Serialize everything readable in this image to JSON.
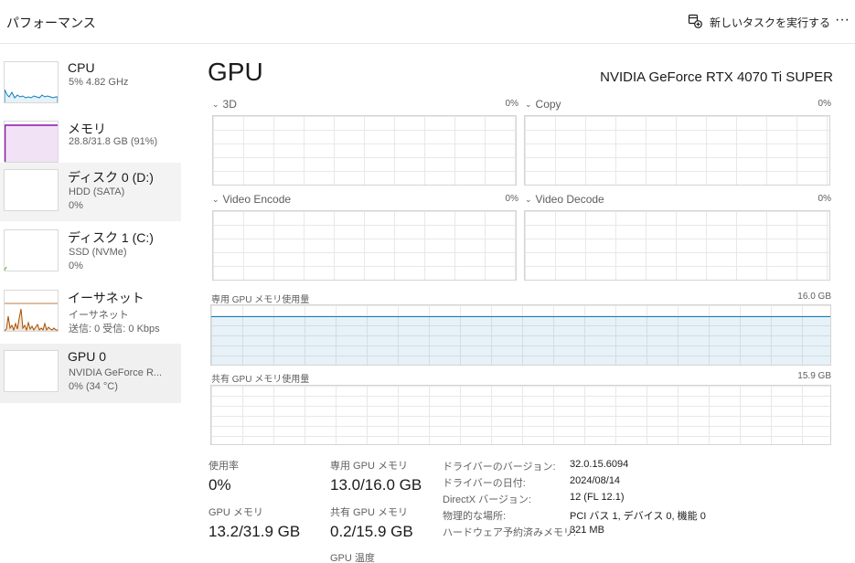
{
  "header": {
    "title": "パフォーマンス",
    "new_task_label": "新しいタスクを実行する",
    "more_label": "···"
  },
  "sidebar": {
    "items": [
      {
        "title": "CPU",
        "sub1": "5%  4.82 GHz",
        "sub2": "",
        "sub3": "",
        "color": "#117dbb"
      },
      {
        "title": "メモリ",
        "sub1": "28.8/31.8 GB (91%)",
        "sub2": "",
        "sub3": "",
        "color": "#8b12ae"
      },
      {
        "title": "ディスク 0 (D:)",
        "sub1": "HDD (SATA)",
        "sub2": "0%",
        "sub3": "",
        "color": "#4da60c"
      },
      {
        "title": "ディスク 1 (C:)",
        "sub1": "SSD (NVMe)",
        "sub2": "0%",
        "sub3": "",
        "color": "#4da60c"
      },
      {
        "title": "イーサネット",
        "sub1": "イーサネット",
        "sub2": "送信: 0 受信: 0 Kbps",
        "sub3": "",
        "color": "#a74f01"
      },
      {
        "title": "GPU 0",
        "sub1": "NVIDIA GeForce R...",
        "sub2": "0% (34 °C)",
        "sub3": "",
        "color": "#117dbb"
      }
    ]
  },
  "main": {
    "title": "GPU",
    "gpu_name": "NVIDIA GeForce RTX 4070 Ti SUPER",
    "engines": [
      {
        "label": "3D",
        "pct": "0%"
      },
      {
        "label": "Copy",
        "pct": "0%"
      },
      {
        "label": "Video Encode",
        "pct": "0%"
      },
      {
        "label": "Video Decode",
        "pct": "0%"
      }
    ],
    "dedicated_mem": {
      "label": "専用 GPU メモリ使用量",
      "max": "16.0 GB",
      "used_fraction": 0.81
    },
    "shared_mem": {
      "label": "共有 GPU メモリ使用量",
      "max": "15.9 GB",
      "used_fraction": 0.0
    }
  },
  "stats": {
    "utilization_label": "使用率",
    "utilization_value": "0%",
    "gpu_memory_label": "GPU メモリ",
    "gpu_memory_value": "13.2/31.9 GB",
    "dedicated_label": "専用 GPU メモリ",
    "dedicated_value": "13.0/16.0 GB",
    "shared_label": "共有 GPU メモリ",
    "shared_value": "0.2/15.9 GB",
    "temp_label": "GPU 温度"
  },
  "info": [
    {
      "key": "ドライバーのバージョン:",
      "value": "32.0.15.6094"
    },
    {
      "key": "ドライバーの日付:",
      "value": "2024/08/14"
    },
    {
      "key": "DirectX バージョン:",
      "value": "12 (FL 12.1)"
    },
    {
      "key": "物理的な場所:",
      "value": "PCI バス 1, デバイス 0, 機能 0"
    },
    {
      "key": "ハードウェア予約済みメモリ:",
      "value": "321 MB"
    }
  ]
}
